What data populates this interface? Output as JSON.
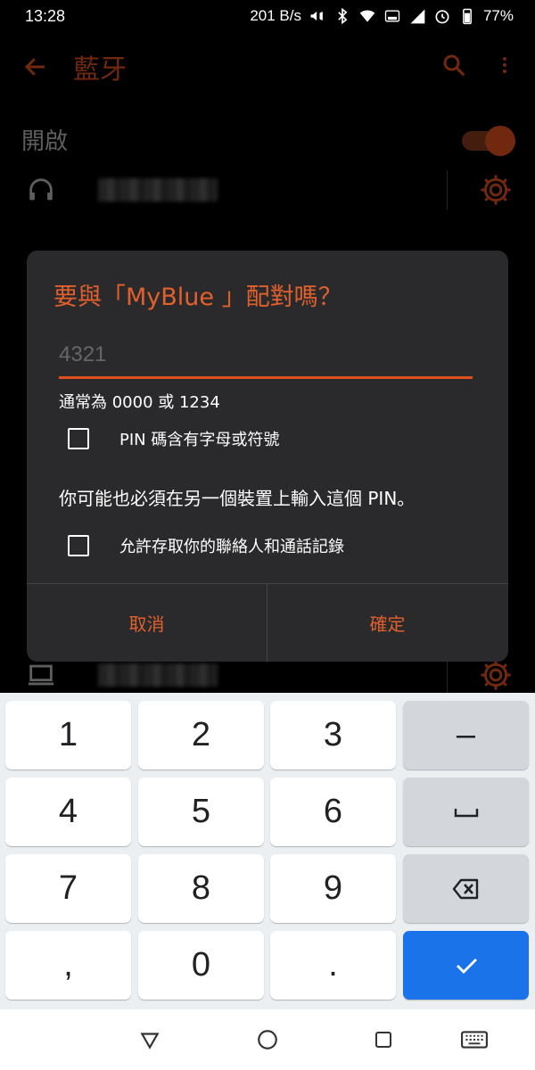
{
  "status_bar": {
    "time": "13:28",
    "net_speed": "201 B/s",
    "battery": "77%"
  },
  "app_bar": {
    "title": "藍牙",
    "icons": [
      "back-arrow-icon",
      "search-icon",
      "more-vert-icon"
    ]
  },
  "bluetooth": {
    "toggle_label": "開啟",
    "enabled": true
  },
  "dialog": {
    "title": "要與「MyBlue 」配對嗎？",
    "pin_placeholder": "4321",
    "hint": "通常為 0000 或 1234",
    "checkbox_pin_letters": "PIN 碼含有字母或符號",
    "note": "你可能也必須在另一個裝置上輸入這個 PIN。",
    "checkbox_contacts": "允許存取你的聯絡人和通話記錄",
    "cancel_label": "取消",
    "ok_label": "確定"
  },
  "keyboard": {
    "keys": [
      [
        "1",
        "2",
        "3",
        "–"
      ],
      [
        "4",
        "5",
        "6",
        "␣"
      ],
      [
        "7",
        "8",
        "9",
        "⌫"
      ],
      [
        ",",
        "0",
        ".",
        "✓"
      ]
    ],
    "accent_color": "#1a73e8"
  },
  "colors": {
    "accent": "#e0501f",
    "dialog_bg": "#2a2a2c"
  }
}
